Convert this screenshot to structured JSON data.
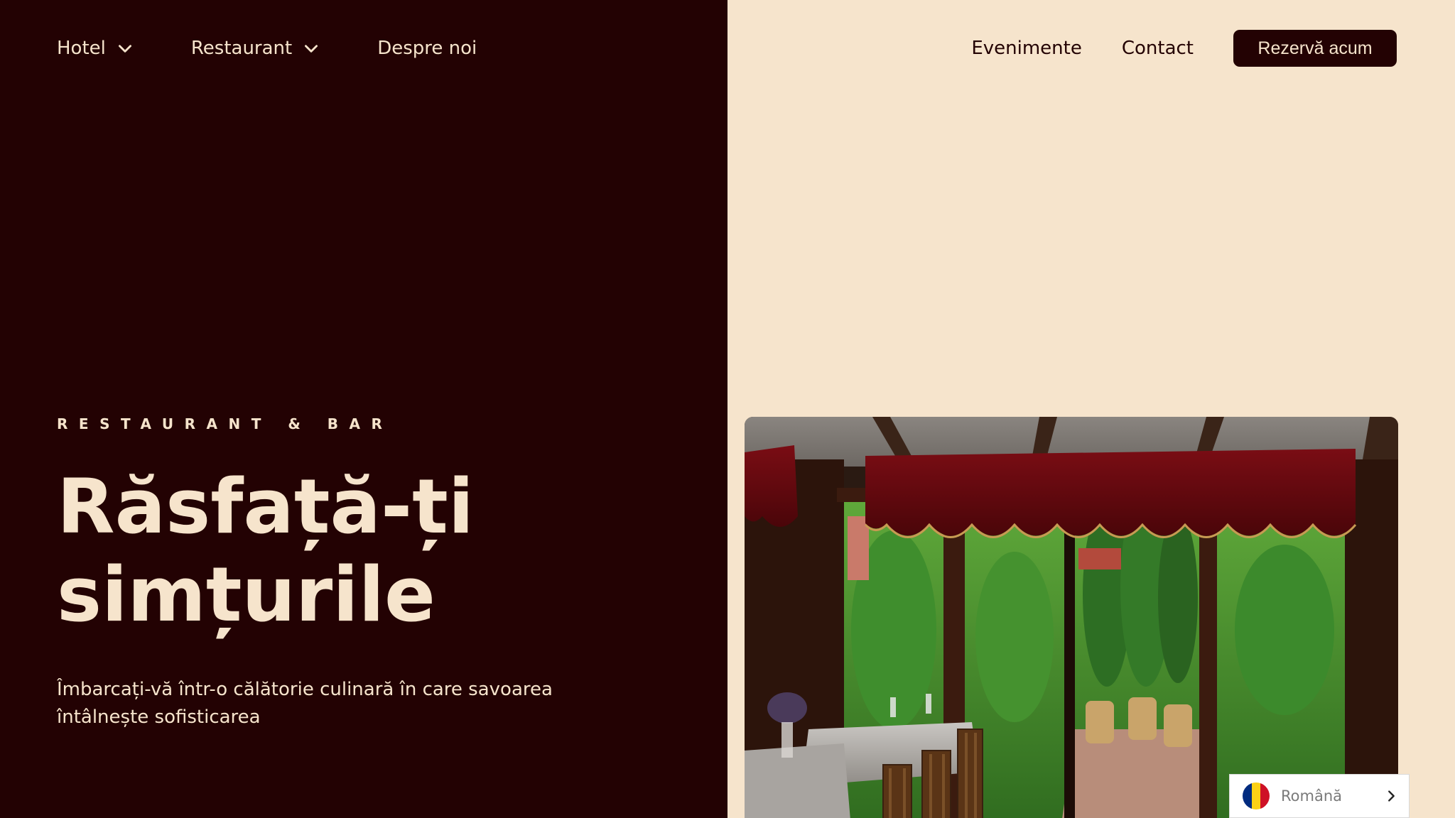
{
  "nav": {
    "left": [
      {
        "label": "Hotel",
        "has_dropdown": true
      },
      {
        "label": "Restaurant",
        "has_dropdown": true
      },
      {
        "label": "Despre noi",
        "has_dropdown": false
      }
    ],
    "right": [
      {
        "label": "Evenimente"
      },
      {
        "label": "Contact"
      }
    ],
    "cta_label": "Rezervă acum"
  },
  "hero": {
    "eyebrow": "RESTAURANT & BAR",
    "title": "Răsfață-ți simțurile",
    "subtitle": "Îmbarcați-vă într-o călătorie culinară în care savoarea întâlnește sofisticarea"
  },
  "image": {
    "subject": "restaurant-terrace-photo"
  },
  "language": {
    "label": "Română",
    "flag_colors": [
      "#002B7F",
      "#FCD116",
      "#CE1126"
    ]
  },
  "colors": {
    "dark": "#230203",
    "cream": "#F6E4CC"
  },
  "icons": {
    "dropdown": "chevron-down-icon",
    "language_arrow": "chevron-right-icon"
  }
}
